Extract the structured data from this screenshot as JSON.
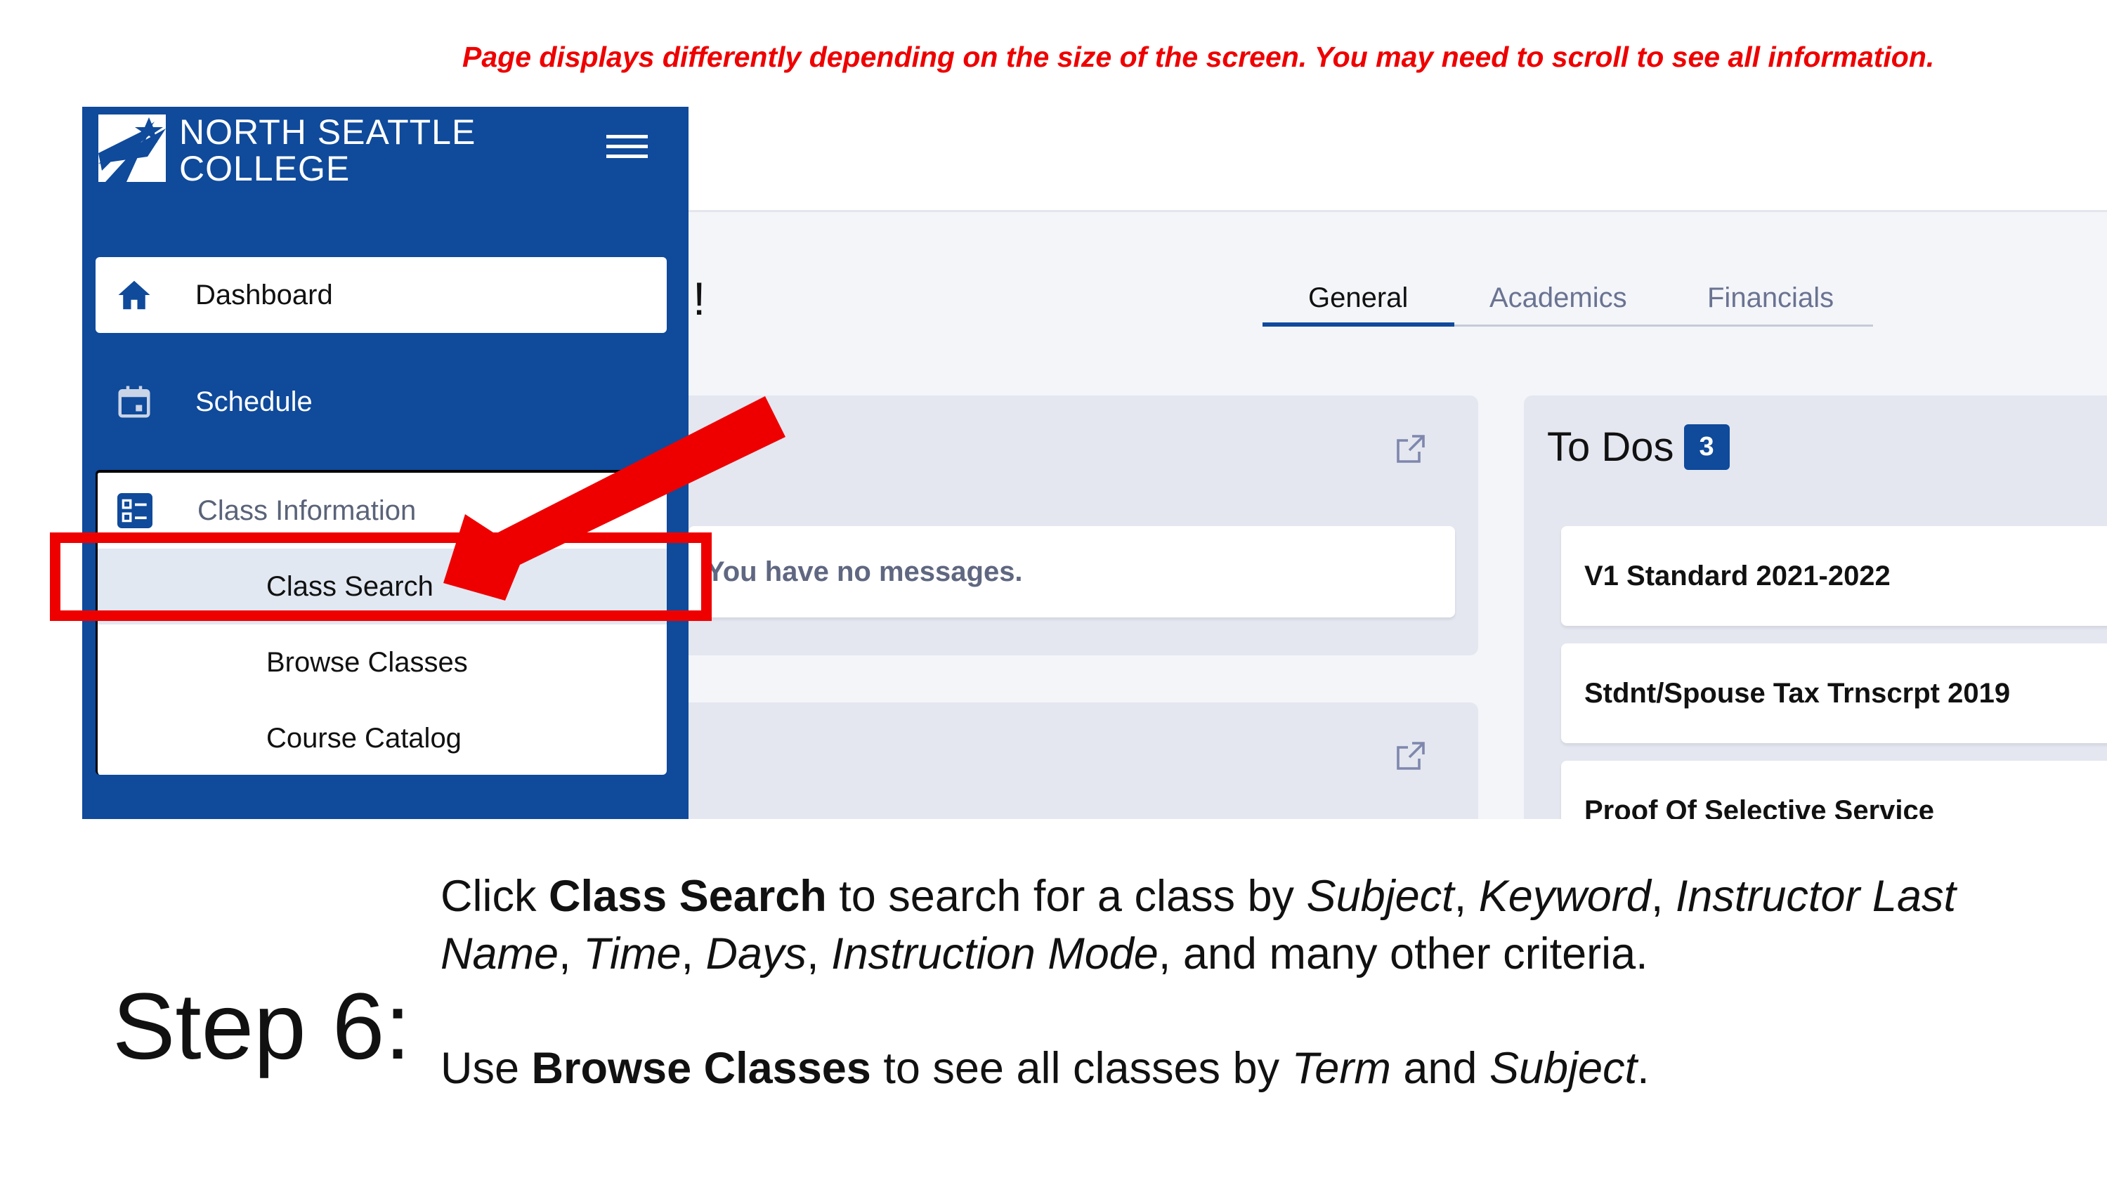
{
  "banner": "Page displays differently depending on the size of the screen. You may need to scroll to see all information.",
  "sidebar": {
    "logo": {
      "line1": "NORTH SEATTLE",
      "line2": "COLLEGE"
    },
    "items": [
      {
        "label": "Dashboard",
        "icon": "home-icon"
      },
      {
        "label": "Schedule",
        "icon": "calendar-icon"
      },
      {
        "label": "Class Information",
        "icon": "list-icon",
        "children": [
          "Class Search",
          "Browse Classes",
          "Course Catalog"
        ]
      }
    ]
  },
  "main": {
    "greeting_fragment": "!",
    "tabs": [
      {
        "label": "General",
        "active": true
      },
      {
        "label": "Academics"
      },
      {
        "label": "Financials"
      }
    ],
    "messages": {
      "empty_text": "You have no messages."
    },
    "todos": {
      "title": "To Dos",
      "count": "3",
      "items": [
        "V1 Standard 2021-2022",
        "Stdnt/Spouse Tax Trnscrpt 2019",
        "Proof Of Selective Service"
      ]
    }
  },
  "instructions": {
    "step": "Step 6:",
    "line1": [
      {
        "t": "Click "
      },
      {
        "t": "Class Search",
        "b": true
      },
      {
        "t": " to search for a class by "
      },
      {
        "t": "Subject",
        "i": true
      },
      {
        "t": ", "
      },
      {
        "t": "Keyword",
        "i": true
      },
      {
        "t": ", "
      },
      {
        "t": "Instructor Last",
        "i": true
      }
    ],
    "line2": [
      {
        "t": "Name",
        "i": true
      },
      {
        "t": ", "
      },
      {
        "t": "Time",
        "i": true
      },
      {
        "t": ", "
      },
      {
        "t": "Days",
        "i": true
      },
      {
        "t": ", "
      },
      {
        "t": "Instruction Mode",
        "i": true
      },
      {
        "t": ", and many other criteria."
      }
    ],
    "line3": [
      {
        "t": "Use "
      },
      {
        "t": "Browse Classes",
        "b": true
      },
      {
        "t": " to see all classes by "
      },
      {
        "t": "Term",
        "i": true
      },
      {
        "t": " and "
      },
      {
        "t": "Subject",
        "i": true
      },
      {
        "t": "."
      }
    ]
  },
  "colors": {
    "brand": "#0f4a9b",
    "annotation": "#ee0000",
    "active_tab": "#0f4a9b"
  }
}
